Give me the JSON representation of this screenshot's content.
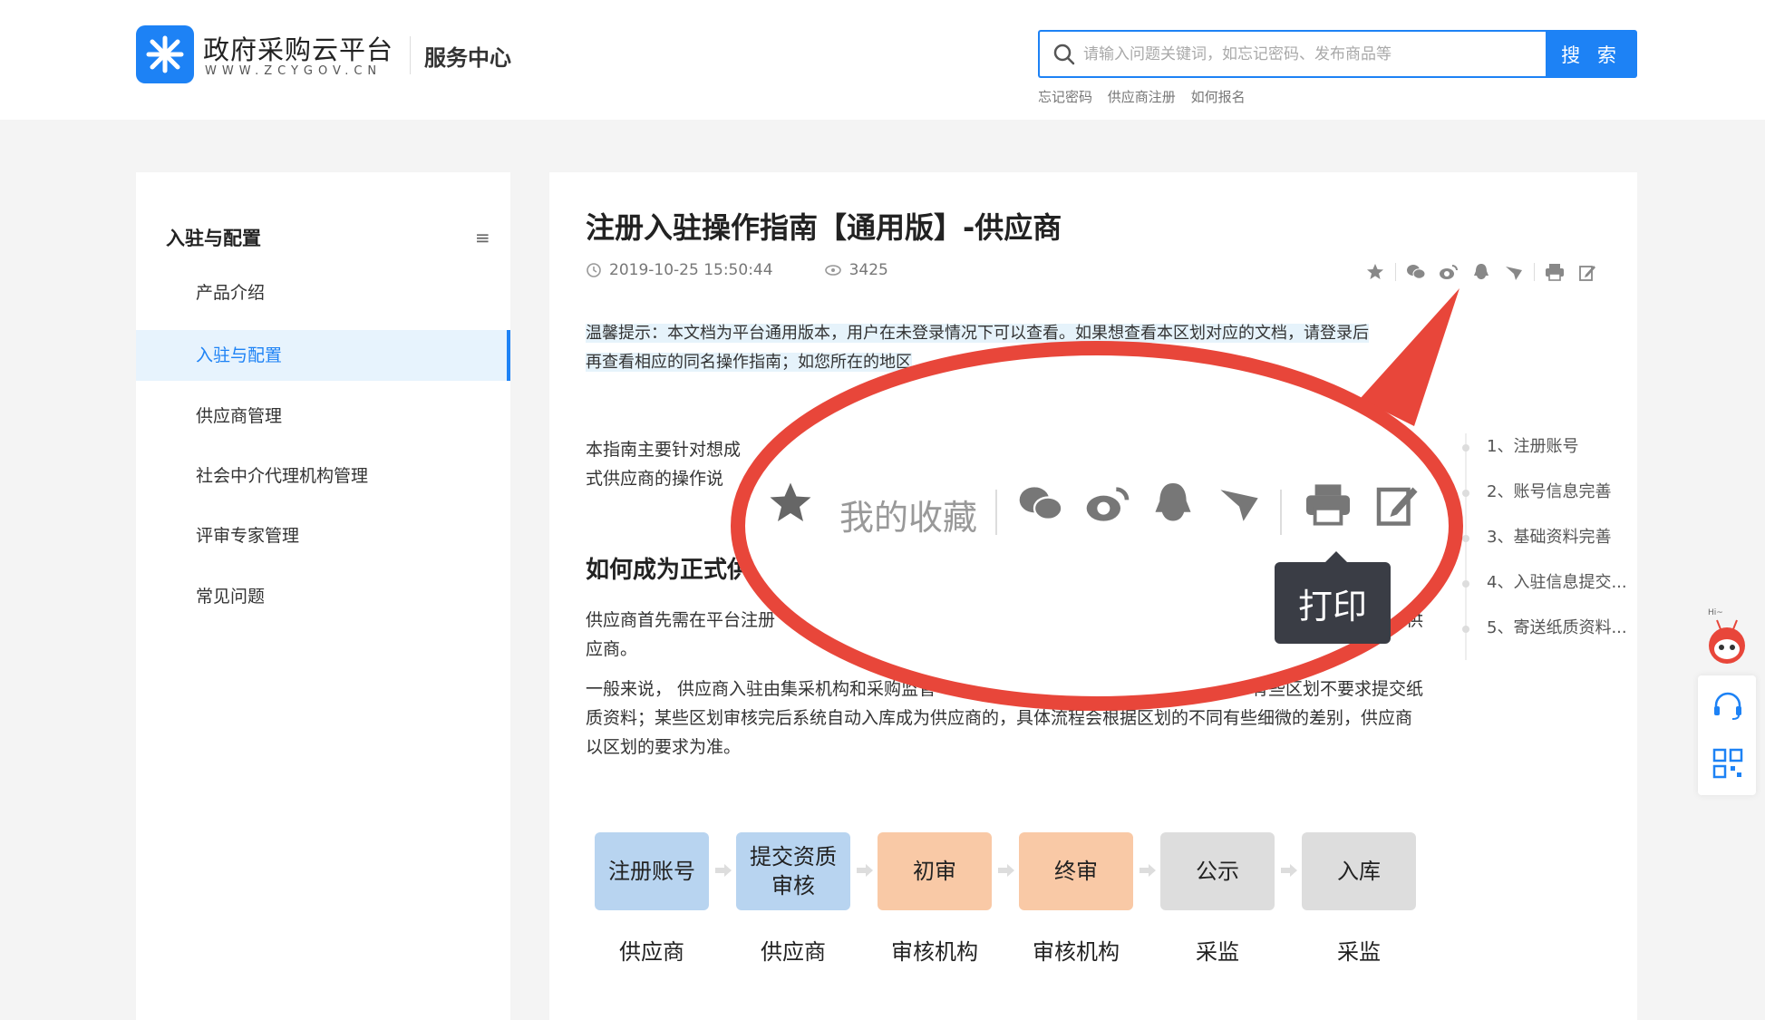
{
  "header": {
    "logo_title": "政府采购云平台",
    "logo_sub": "WWW.ZCYGOV.CN",
    "service_center": "服务中心",
    "search_placeholder": "请输入问题关键词，如忘记密码、发布商品等",
    "search_button": "搜 索",
    "hot_links": [
      "忘记密码",
      "供应商注册",
      "如何报名"
    ],
    "accent_color": "#1d82f5"
  },
  "sidebar": {
    "heading": "入驻与配置",
    "items": [
      {
        "label": "产品介绍",
        "active": false
      },
      {
        "label": "入驻与配置",
        "active": true
      },
      {
        "label": "供应商管理",
        "active": false
      },
      {
        "label": "社会中介代理机构管理",
        "active": false
      },
      {
        "label": "评审专家管理",
        "active": false
      },
      {
        "label": "常见问题",
        "active": false
      }
    ]
  },
  "article": {
    "title": "注册入驻操作指南【通用版】-供应商",
    "date": "2019-10-25 15:50:44",
    "views": "3425",
    "notice_line1": "温馨提示：本文档为平台通用版本，用户在未登录情况下可以查看。如果想查看本区划对应的文档，请登录后",
    "notice_line2": "再查看相应的同名操作指南；如您所在的地区",
    "intro_line1": "本指南主要针对想成",
    "intro_line2": "式供应商的操作说",
    "section_heading": "如何成为正式供",
    "p1_line1": "供应商首先需在平台注册",
    "p1_tail": "供",
    "p1_line2": "应商。",
    "p2_line1_a": "一般来说， 供应商入驻由集采机构和采购监管",
    "p2_line1_b": "有些区划不要求提交纸",
    "p2_line2": "质资料；某些区划审核完后系统自动入库成为供应商的，具体流程会根据区划的不同有些细微的差别，供应商",
    "p2_line3": "以区划的要求为准。"
  },
  "toc": [
    "1、注册账号",
    "2、账号信息完善",
    "3、基础资料完善",
    "4、入驻信息提交...",
    "5、寄送纸质资料..."
  ],
  "flow": [
    {
      "step": "注册账号",
      "role": "供应商",
      "color": "#b8d4f0"
    },
    {
      "step": "提交资质审核",
      "role": "供应商",
      "color": "#b8d4f0"
    },
    {
      "step": "初审",
      "role": "审核机构",
      "color": "#f9c9a6"
    },
    {
      "step": "终审",
      "role": "审核机构",
      "color": "#f9c9a6"
    },
    {
      "step": "公示",
      "role": "采监",
      "color": "#dddddd"
    },
    {
      "step": "入库",
      "role": "采监",
      "color": "#dddddd"
    }
  ],
  "zoom": {
    "favorite_label": "我的收藏",
    "print_tooltip": "打印",
    "annotation_color": "#e8463a"
  },
  "float_tools": {
    "mascot_greeting": "Hi~"
  }
}
